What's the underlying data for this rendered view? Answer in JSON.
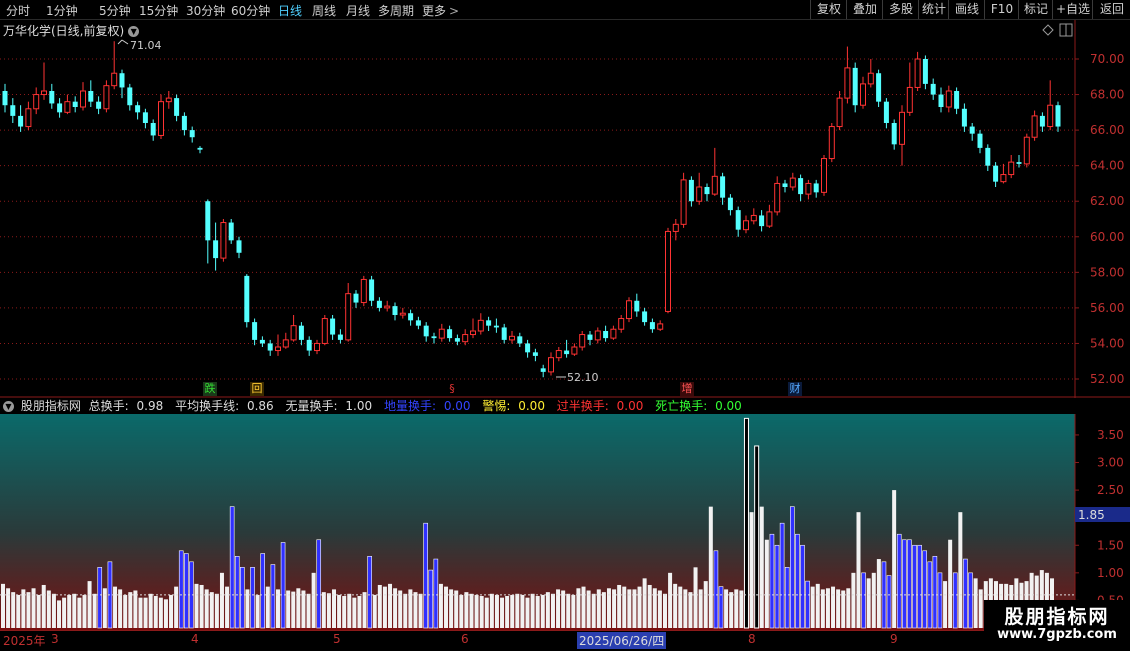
{
  "toolbar": {
    "periods": [
      "分时",
      "1分钟",
      "5分钟",
      "15分钟",
      "30分钟",
      "60分钟",
      "日线",
      "周线",
      "月线",
      "多周期",
      "更多"
    ],
    "active": "日线",
    "actions": [
      "复权",
      "叠加",
      "多股",
      "统计",
      "画线",
      "F10",
      "标记",
      "+自选",
      "返回"
    ]
  },
  "stock": {
    "title": "万华化学(日线,前复权)"
  },
  "price_axis": {
    "ticks": [
      "70.00",
      "68.00",
      "66.00",
      "64.00",
      "62.00",
      "60.00",
      "58.00",
      "56.00",
      "54.00",
      "52.00"
    ]
  },
  "annotations": {
    "high": "71.04",
    "low": "52.10"
  },
  "markers": [
    {
      "text": "跌",
      "color": "#33dd33",
      "bg": "#1a3a1a"
    },
    {
      "text": "回",
      "color": "#ffcc33",
      "bg": "#3a2a00"
    },
    {
      "text": "§",
      "color": "#dd3333",
      "bg": "#000000"
    },
    {
      "text": "增",
      "color": "#ff5555",
      "bg": "#3a0a0a"
    },
    {
      "text": "财",
      "color": "#55aaff",
      "bg": "#0a1a3a"
    }
  ],
  "indicator": {
    "name": "股朋指标网",
    "total_label": "总换手:",
    "total_value": "0.98",
    "avg_label": "平均换手线:",
    "avg_value": "0.86",
    "none_label": "无量换手:",
    "none_value": "1.00",
    "base_label": "地量换手:",
    "base_value": "0.00",
    "warn_label": "警惕:",
    "warn_value": "0.00",
    "half_label": "过半换手:",
    "half_value": "0.00",
    "dead_label": "死亡换手:",
    "dead_value": "0.00",
    "axis_ticks": [
      "3.50",
      "3.00",
      "2.50",
      "2.00",
      "1.50",
      "1.00",
      "0.50"
    ],
    "current_tag": "1.85"
  },
  "date_axis": {
    "labels": [
      "2025年",
      "3",
      "4",
      "5",
      "6",
      "2025/06/26/四",
      "8",
      "9"
    ],
    "selected": "2025/06/26/四"
  },
  "watermark": {
    "name": "股朋指标网",
    "url": "www.7gpzb.com"
  },
  "colors": {
    "up": "#ff3333",
    "down": "#54ffff",
    "grid": "#8b1a1a",
    "blue_bar": "#3030ff"
  },
  "chart_data": {
    "type": "candlestick",
    "ylim": [
      51.2,
      71.4
    ],
    "candles": [
      [
        68.2,
        67.4,
        68.6,
        67.0
      ],
      [
        67.4,
        66.8,
        67.8,
        66.4
      ],
      [
        66.8,
        66.2,
        67.4,
        65.9
      ],
      [
        66.2,
        67.2,
        67.6,
        66.0
      ],
      [
        67.2,
        68.0,
        68.4,
        66.9
      ],
      [
        68.0,
        68.2,
        69.8,
        67.7
      ],
      [
        68.2,
        67.5,
        68.6,
        67.2
      ],
      [
        67.5,
        67.0,
        67.8,
        66.7
      ],
      [
        67.0,
        67.6,
        68.0,
        66.9
      ],
      [
        67.6,
        67.3,
        67.9,
        67.0
      ],
      [
        67.3,
        68.2,
        68.7,
        67.1
      ],
      [
        68.2,
        67.6,
        68.8,
        67.3
      ],
      [
        67.6,
        67.2,
        67.9,
        66.9
      ],
      [
        67.2,
        68.5,
        68.8,
        67.0
      ],
      [
        68.5,
        69.2,
        71.0,
        68.3
      ],
      [
        69.2,
        68.4,
        69.4,
        67.8
      ],
      [
        68.4,
        67.4,
        68.6,
        67.1
      ],
      [
        67.4,
        67.0,
        67.6,
        66.6
      ],
      [
        67.0,
        66.4,
        67.2,
        66.1
      ],
      [
        66.4,
        65.7,
        66.6,
        65.4
      ],
      [
        65.7,
        67.6,
        68.0,
        65.5
      ],
      [
        67.6,
        67.8,
        68.2,
        67.2
      ],
      [
        67.8,
        66.8,
        68.0,
        66.5
      ],
      [
        66.8,
        66.0,
        67.0,
        65.7
      ],
      [
        66.0,
        65.6,
        66.2,
        65.3
      ],
      [
        65.0,
        64.9,
        65.1,
        64.7
      ],
      [
        62.0,
        59.8,
        62.1,
        58.5
      ],
      [
        59.8,
        58.8,
        60.8,
        58.1
      ],
      [
        58.8,
        60.8,
        61.0,
        58.6
      ],
      [
        60.8,
        59.8,
        61.0,
        59.6
      ],
      [
        59.8,
        59.1,
        60.0,
        58.8
      ],
      [
        57.8,
        55.2,
        57.9,
        54.9
      ],
      [
        55.2,
        54.2,
        55.4,
        53.9
      ],
      [
        54.2,
        54.0,
        54.4,
        53.8
      ],
      [
        54.0,
        53.6,
        54.2,
        53.3
      ],
      [
        53.6,
        53.8,
        54.5,
        53.3
      ],
      [
        53.8,
        54.2,
        54.6,
        53.7
      ],
      [
        54.2,
        55.0,
        55.6,
        54.1
      ],
      [
        55.0,
        54.2,
        55.2,
        53.9
      ],
      [
        54.2,
        53.6,
        54.4,
        53.3
      ],
      [
        53.6,
        54.0,
        54.2,
        53.4
      ],
      [
        54.0,
        55.4,
        55.6,
        53.9
      ],
      [
        55.4,
        54.5,
        55.6,
        54.2
      ],
      [
        54.5,
        54.2,
        54.8,
        54.0
      ],
      [
        54.2,
        56.8,
        57.4,
        54.1
      ],
      [
        56.8,
        56.3,
        57.0,
        56.0
      ],
      [
        56.3,
        57.6,
        57.8,
        56.1
      ],
      [
        57.6,
        56.4,
        57.8,
        56.1
      ],
      [
        56.4,
        56.0,
        56.6,
        55.8
      ],
      [
        56.0,
        56.1,
        56.4,
        55.8
      ],
      [
        56.1,
        55.6,
        56.3,
        55.3
      ],
      [
        55.6,
        55.7,
        56.0,
        55.4
      ],
      [
        55.7,
        55.3,
        55.9,
        55.0
      ],
      [
        55.3,
        55.0,
        55.5,
        54.8
      ],
      [
        55.0,
        54.4,
        55.2,
        54.1
      ],
      [
        54.4,
        54.3,
        54.6,
        54.0
      ],
      [
        54.3,
        54.8,
        55.1,
        54.1
      ],
      [
        54.8,
        54.3,
        55.0,
        54.1
      ],
      [
        54.3,
        54.1,
        54.5,
        53.9
      ],
      [
        54.1,
        54.5,
        54.8,
        53.9
      ],
      [
        54.5,
        54.7,
        55.4,
        54.3
      ],
      [
        54.7,
        55.3,
        55.7,
        54.5
      ],
      [
        55.3,
        55.0,
        55.5,
        54.7
      ],
      [
        55.0,
        54.9,
        55.4,
        54.6
      ],
      [
        54.9,
        54.2,
        55.1,
        54.0
      ],
      [
        54.2,
        54.4,
        54.7,
        54.0
      ],
      [
        54.4,
        54.0,
        54.6,
        53.8
      ],
      [
        54.0,
        53.5,
        54.2,
        53.2
      ],
      [
        53.5,
        53.3,
        53.7,
        53.0
      ],
      [
        52.6,
        52.4,
        52.8,
        52.1
      ],
      [
        52.4,
        53.2,
        53.5,
        52.2
      ],
      [
        53.2,
        53.6,
        53.8,
        53.0
      ],
      [
        53.6,
        53.4,
        54.2,
        53.2
      ],
      [
        53.4,
        53.8,
        54.0,
        53.3
      ],
      [
        53.8,
        54.5,
        54.7,
        53.6
      ],
      [
        54.5,
        54.2,
        54.7,
        53.9
      ],
      [
        54.2,
        54.7,
        54.9,
        54.0
      ],
      [
        54.7,
        54.3,
        55.0,
        54.1
      ],
      [
        54.3,
        54.8,
        55.0,
        54.2
      ],
      [
        54.8,
        55.4,
        55.6,
        54.6
      ],
      [
        55.4,
        56.4,
        56.6,
        55.2
      ],
      [
        56.4,
        55.8,
        56.8,
        55.5
      ],
      [
        55.8,
        55.2,
        56.0,
        55.0
      ],
      [
        55.2,
        54.8,
        55.4,
        54.6
      ],
      [
        54.8,
        55.1,
        55.3,
        54.7
      ],
      [
        55.8,
        60.3,
        60.5,
        55.7
      ],
      [
        60.3,
        60.7,
        61.0,
        59.8
      ],
      [
        60.7,
        63.2,
        63.6,
        60.5
      ],
      [
        63.2,
        62.0,
        63.4,
        61.7
      ],
      [
        62.0,
        62.8,
        63.6,
        61.8
      ],
      [
        62.8,
        62.4,
        63.0,
        62.0
      ],
      [
        62.4,
        63.4,
        65.0,
        62.3
      ],
      [
        63.4,
        62.2,
        63.6,
        61.8
      ],
      [
        62.2,
        61.5,
        62.4,
        61.2
      ],
      [
        61.5,
        60.4,
        61.7,
        60.0
      ],
      [
        60.4,
        60.9,
        61.2,
        60.2
      ],
      [
        60.9,
        61.2,
        61.6,
        60.7
      ],
      [
        61.2,
        60.6,
        61.5,
        60.3
      ],
      [
        60.6,
        61.4,
        61.8,
        60.5
      ],
      [
        61.4,
        63.0,
        63.4,
        61.2
      ],
      [
        63.0,
        62.8,
        63.2,
        62.5
      ],
      [
        62.8,
        63.3,
        63.6,
        62.6
      ],
      [
        63.3,
        62.4,
        63.5,
        62.0
      ],
      [
        62.4,
        63.0,
        63.2,
        62.1
      ],
      [
        63.0,
        62.5,
        63.2,
        62.2
      ],
      [
        62.5,
        64.4,
        64.6,
        62.3
      ],
      [
        64.4,
        66.2,
        66.4,
        64.2
      ],
      [
        66.2,
        67.8,
        68.2,
        66.0
      ],
      [
        67.8,
        69.5,
        70.7,
        67.5
      ],
      [
        69.5,
        67.4,
        69.8,
        67.0
      ],
      [
        67.4,
        68.6,
        69.0,
        67.2
      ],
      [
        68.6,
        69.2,
        70.0,
        68.4
      ],
      [
        69.2,
        67.6,
        69.4,
        67.3
      ],
      [
        67.6,
        66.4,
        67.8,
        66.1
      ],
      [
        66.4,
        65.2,
        66.6,
        64.9
      ],
      [
        65.2,
        67.0,
        67.4,
        64.0
      ],
      [
        67.0,
        68.4,
        69.8,
        66.8
      ],
      [
        68.4,
        70.0,
        70.4,
        68.2
      ],
      [
        70.0,
        68.6,
        70.2,
        68.3
      ],
      [
        68.6,
        68.0,
        68.9,
        67.7
      ],
      [
        68.0,
        67.3,
        68.4,
        67.0
      ],
      [
        67.3,
        68.2,
        68.5,
        67.0
      ],
      [
        68.2,
        67.2,
        68.4,
        66.9
      ],
      [
        67.2,
        66.2,
        67.5,
        65.9
      ],
      [
        66.2,
        65.8,
        66.4,
        65.4
      ],
      [
        65.8,
        65.0,
        66.0,
        64.7
      ],
      [
        65.0,
        64.0,
        65.2,
        63.7
      ],
      [
        64.0,
        63.1,
        64.2,
        62.8
      ],
      [
        63.1,
        63.5,
        64.1,
        63.0
      ],
      [
        63.5,
        64.2,
        64.6,
        63.3
      ],
      [
        64.2,
        64.1,
        64.6,
        63.9
      ],
      [
        64.1,
        65.6,
        65.8,
        63.9
      ],
      [
        65.6,
        66.8,
        67.1,
        65.4
      ],
      [
        66.8,
        66.2,
        67.0,
        65.9
      ],
      [
        66.2,
        67.4,
        68.8,
        66.0
      ],
      [
        67.4,
        66.2,
        67.6,
        65.9
      ]
    ]
  },
  "volume_data": {
    "type": "bar",
    "ylim": [
      0,
      3.9
    ],
    "avg": 0.6,
    "values": [
      0.8,
      0.72,
      0.65,
      0.6,
      0.7,
      0.65,
      0.72,
      0.6,
      0.78,
      0.68,
      0.62,
      0.5,
      0.55,
      0.6,
      0.62,
      0.55,
      0.6,
      0.85,
      0.62,
      1.1,
      0.72,
      1.2,
      0.75,
      0.7,
      0.6,
      0.65,
      0.68,
      0.55,
      0.55,
      0.62,
      0.58,
      0.55,
      0.52,
      0.6,
      0.75,
      1.4,
      1.35,
      1.2,
      0.8,
      0.78,
      0.7,
      0.65,
      0.62,
      1.0,
      0.75,
      2.2,
      1.3,
      1.1,
      0.7,
      1.1,
      0.6,
      1.35,
      0.75,
      1.15,
      0.7,
      1.55,
      0.68,
      0.66,
      0.72,
      0.68,
      0.62,
      1.0,
      1.6,
      0.65,
      0.63,
      0.7,
      0.6,
      0.58,
      0.62,
      0.55,
      0.58,
      0.65,
      1.3,
      0.6,
      0.78,
      0.75,
      0.8,
      0.72,
      0.68,
      0.62,
      0.7,
      0.65,
      0.62,
      1.9,
      1.05,
      1.25,
      0.8,
      0.75,
      0.7,
      0.68,
      0.6,
      0.65,
      0.62,
      0.6,
      0.58,
      0.55,
      0.62,
      0.6,
      0.55,
      0.58,
      0.6,
      0.62,
      0.6,
      0.55,
      0.62,
      0.58,
      0.6,
      0.65,
      0.62,
      0.7,
      0.68,
      0.62,
      0.6,
      0.72,
      0.75,
      0.68,
      0.62,
      0.7,
      0.65,
      0.72,
      0.7,
      0.78,
      0.75,
      0.7,
      0.7,
      0.75,
      0.9,
      0.78,
      0.72,
      0.68,
      0.62,
      1.0,
      0.8,
      0.75,
      0.7,
      0.65,
      1.1,
      0.7,
      0.85,
      2.2,
      1.4,
      0.75,
      0.7,
      0.65,
      0.7,
      0.68,
      3.8,
      2.1,
      3.3,
      2.2,
      1.6,
      1.7,
      1.5,
      1.9,
      1.1,
      2.2,
      1.7,
      1.5,
      0.85,
      0.75,
      0.8,
      0.7,
      0.72,
      0.75,
      0.7,
      0.68,
      0.72,
      1.0,
      2.1,
      1.0,
      0.9,
      1.0,
      1.25,
      1.2,
      0.95,
      2.5,
      1.7,
      1.6,
      1.6,
      1.5,
      1.5,
      1.4,
      1.2,
      1.3,
      1.0,
      0.85,
      1.6,
      1.0,
      2.1,
      1.25,
      1.0,
      0.9,
      0.7,
      0.85,
      0.9,
      0.85,
      0.8,
      0.8,
      0.78,
      0.9,
      0.82,
      0.85,
      1.0,
      0.95,
      1.05,
      1.0,
      0.9
    ],
    "blue_values": [
      0,
      0,
      0,
      0,
      0,
      0,
      0,
      0,
      0,
      0,
      0,
      0,
      0,
      0,
      0,
      0,
      0,
      0,
      0,
      1.1,
      0,
      1.2,
      0,
      0,
      0,
      0,
      0,
      0,
      0,
      0,
      0,
      0,
      0,
      0,
      0,
      1.4,
      1.35,
      1.2,
      0,
      0,
      0,
      0,
      0,
      0,
      0,
      2.2,
      1.3,
      1.1,
      0,
      1.1,
      0,
      1.35,
      0,
      1.15,
      0,
      1.55,
      0,
      0,
      0,
      0,
      0,
      0,
      1.6,
      0,
      0,
      0,
      0,
      0,
      0,
      0,
      0,
      0,
      1.3,
      0,
      0,
      0,
      0,
      0,
      0,
      0,
      0,
      0,
      0,
      1.9,
      1.05,
      1.25,
      0,
      0,
      0,
      0,
      0,
      0,
      0,
      0,
      0,
      0,
      0,
      0,
      0,
      0,
      0,
      0,
      0,
      0,
      0,
      0,
      0,
      0,
      0,
      0,
      0,
      0,
      0,
      0,
      0,
      0,
      0,
      0,
      0,
      0,
      0,
      0,
      0,
      0,
      0,
      0,
      0,
      0,
      0,
      0,
      0,
      0,
      0,
      0,
      0,
      0,
      0,
      0,
      0,
      0,
      2.2,
      1.4,
      0,
      0,
      0,
      0,
      0,
      0,
      0,
      0,
      0,
      1.6,
      1.7,
      1.5,
      1.9,
      1.1,
      2.2,
      1.7,
      1.5,
      0,
      0,
      0,
      0,
      0,
      0,
      0,
      0,
      0,
      0,
      2.1,
      0,
      0,
      0,
      1.25,
      1.2,
      0,
      2.5,
      1.7,
      1.6,
      1.6,
      1.5,
      1.5,
      1.4,
      1.2,
      1.3,
      0,
      0,
      1.6,
      0,
      2.1,
      1.25,
      0,
      0,
      0,
      0,
      0,
      0,
      0,
      0,
      0,
      0,
      0,
      0,
      0,
      0,
      0,
      0,
      0
    ]
  }
}
